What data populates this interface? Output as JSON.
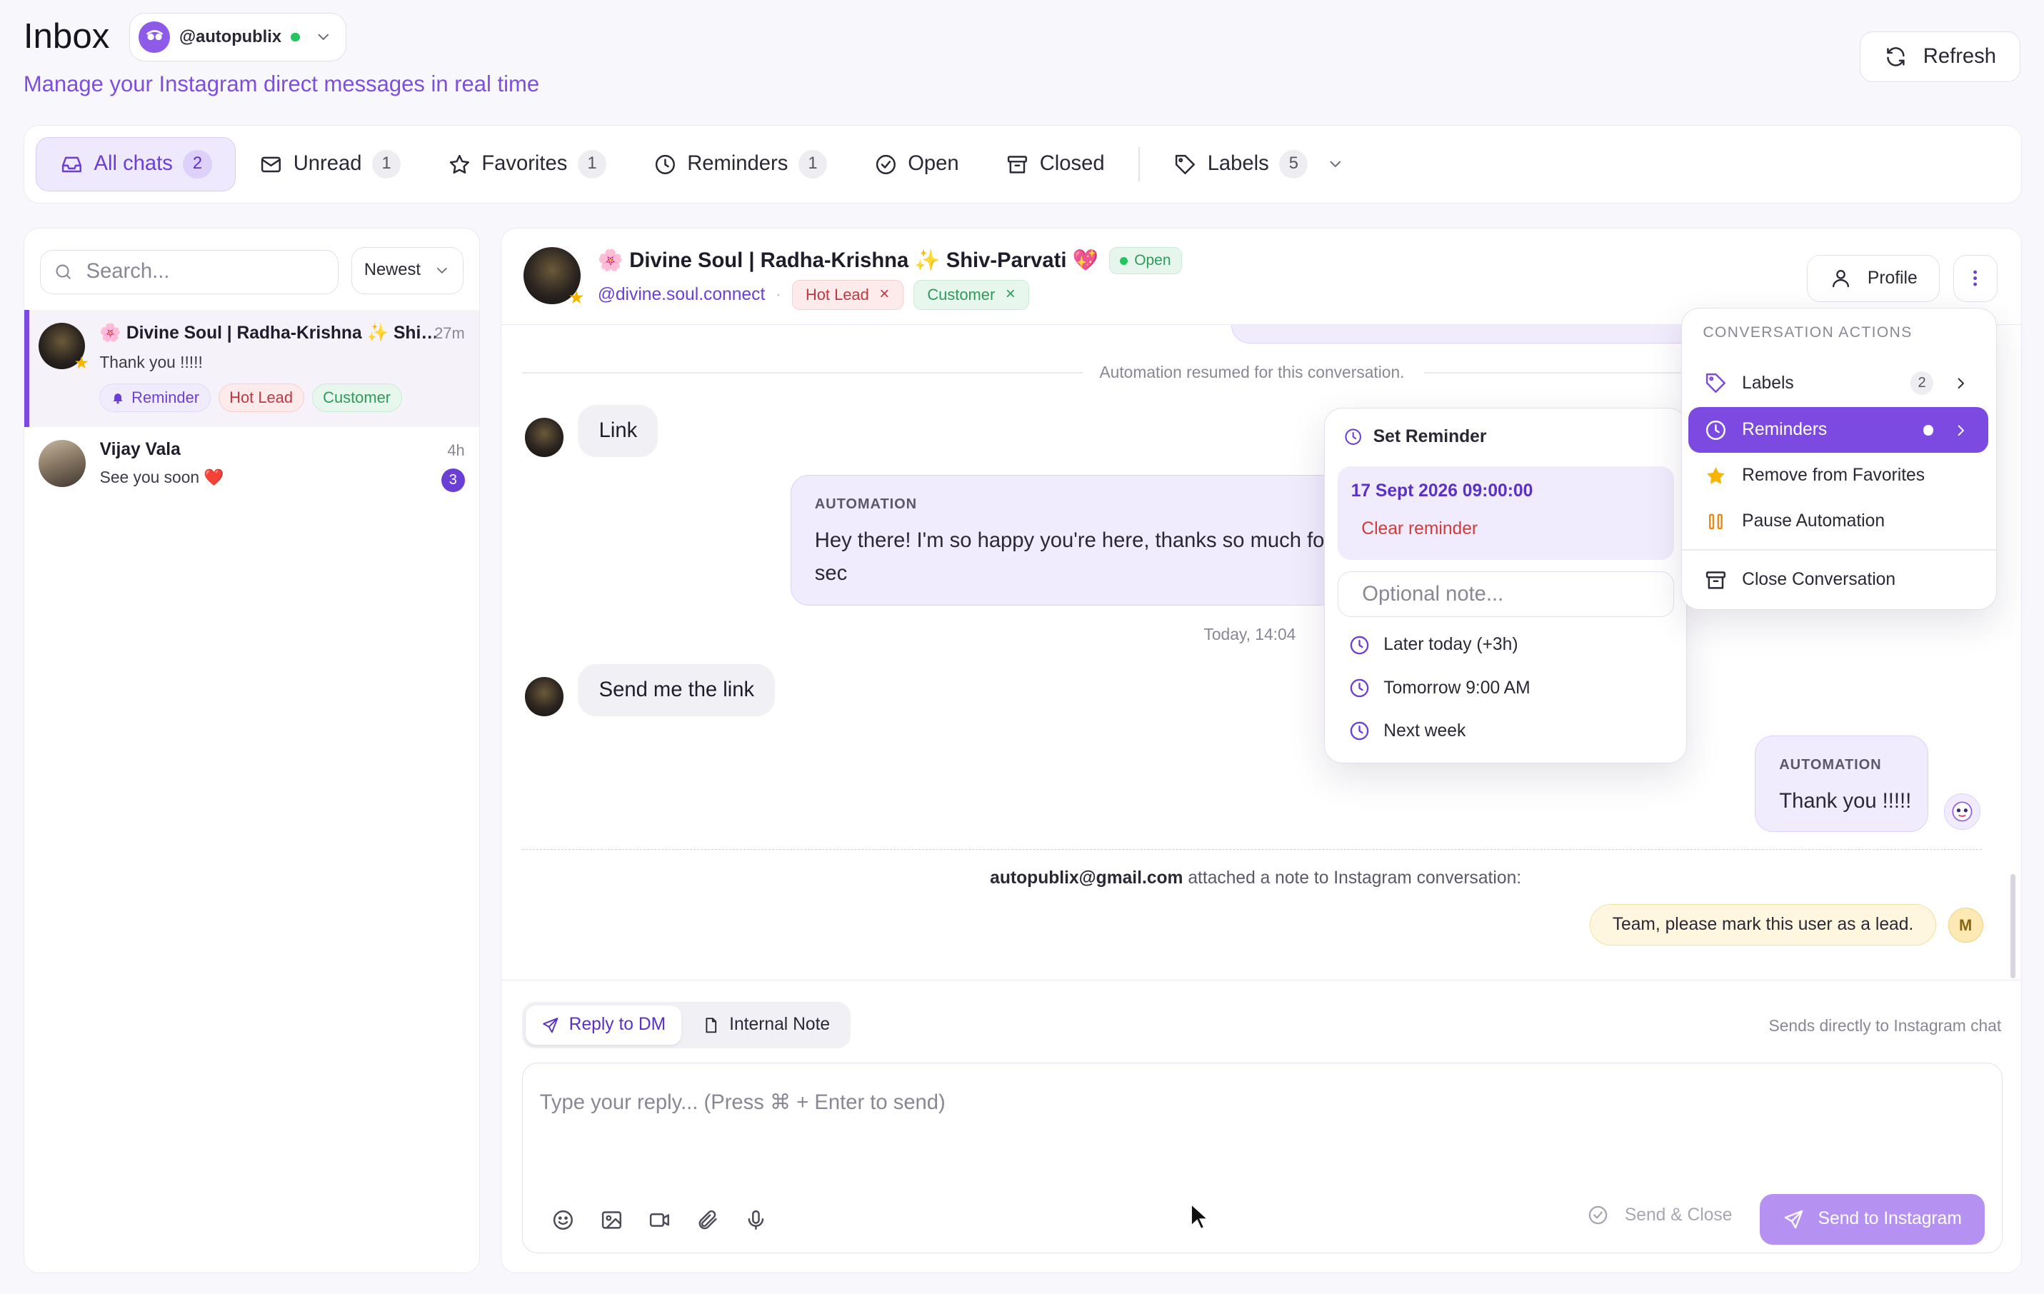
{
  "header": {
    "title": "Inbox",
    "account": "@autopublix",
    "subtitle": "Manage your Instagram direct messages in real time",
    "refresh_label": "Refresh"
  },
  "filters": [
    {
      "label": "All chats",
      "count": "2",
      "icon": "inbox-icon"
    },
    {
      "label": "Unread",
      "count": "1",
      "icon": "mail-icon"
    },
    {
      "label": "Favorites",
      "count": "1",
      "icon": "star-icon"
    },
    {
      "label": "Reminders",
      "count": "1",
      "icon": "clock-icon"
    },
    {
      "label": "Open",
      "count": "",
      "icon": "check-circle-icon"
    },
    {
      "label": "Closed",
      "count": "",
      "icon": "archive-icon"
    },
    {
      "label": "Labels",
      "count": "5",
      "icon": "tag-icon"
    }
  ],
  "sidebar": {
    "search_placeholder": "Search...",
    "sort_label": "Newest",
    "conversations": [
      {
        "name": "🌸 Divine Soul | Radha-Krishna ✨ Shiv...",
        "time": "27m",
        "message": "Thank you !!!!!",
        "chips": [
          "Reminder",
          "Hot Lead",
          "Customer"
        ]
      },
      {
        "name": "Vijay Vala",
        "time": "4h",
        "message": "See you soon ❤️",
        "unread": "3"
      }
    ]
  },
  "conversation": {
    "name": "🌸 Divine Soul | Radha-Krishna ✨ Shiv-Parvati 💖",
    "status": "Open",
    "handle": "@divine.soul.connect",
    "labels": [
      "Hot Lead",
      "Customer"
    ],
    "profile_label": "Profile"
  },
  "messages": {
    "system_resumed": "Automation resumed for this conversation.",
    "incoming_link": "Link",
    "automation_label": "AUTOMATION",
    "automation_text_1": "Hey there! I'm so happy you're here, thanks so much for",
    "automation_text_2": "sec",
    "timestamp": "Today, 14:04",
    "incoming_send_link": "Send me the link",
    "automation_thanks": "Thank you !!!!!",
    "note_author": "autopublix@gmail.com",
    "note_action": "attached a note to Instagram conversation:",
    "note_text": "Team, please mark this user as a lead.",
    "note_avatar": "M"
  },
  "reminder_popover": {
    "title": "Set Reminder",
    "current": "17 Sept 2026 09:00:00",
    "clear": "Clear reminder",
    "note_placeholder": "Optional note...",
    "options": [
      "Later today (+3h)",
      "Tomorrow 9:00 AM",
      "Next week"
    ]
  },
  "actions_menu": {
    "title": "CONVERSATION ACTIONS",
    "items": [
      {
        "label": "Labels",
        "badge": "2"
      },
      {
        "label": "Reminders"
      },
      {
        "label": "Remove from Favorites"
      },
      {
        "label": "Pause Automation"
      },
      {
        "label": "Close Conversation"
      }
    ]
  },
  "composer": {
    "tab_reply": "Reply to DM",
    "tab_note": "Internal Note",
    "hint": "Sends directly to Instagram chat",
    "placeholder": "Type your reply... (Press ⌘ + Enter to send)",
    "send_close": "Send & Close",
    "send": "Send to Instagram"
  },
  "colors": {
    "accent": "#7c4ae0",
    "accent_light": "#efe9fd",
    "hot_lead": "#c2363f",
    "customer": "#2f9a59",
    "open_status": "#22c55e"
  }
}
